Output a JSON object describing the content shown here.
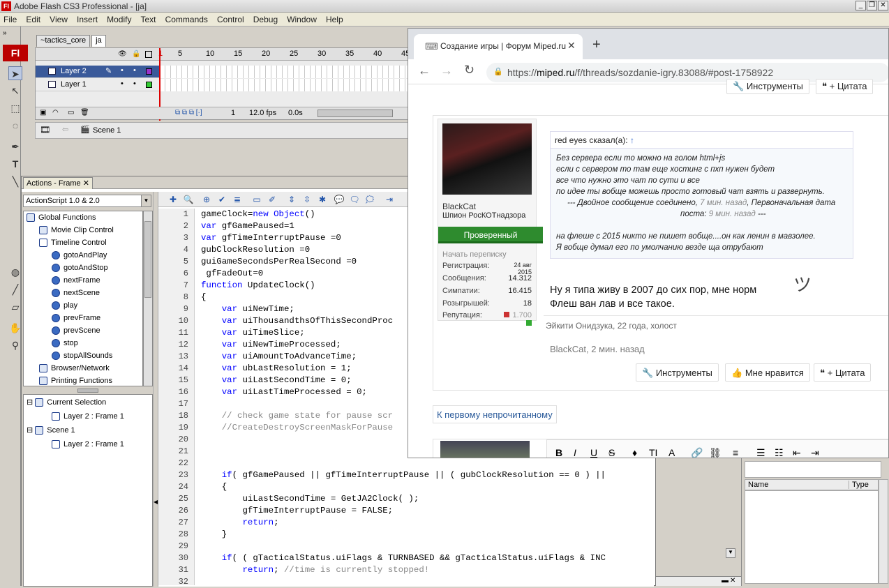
{
  "app": {
    "title": "Adobe Flash CS3 Professional - [ja]",
    "logo": "Fl",
    "menu": [
      "File",
      "Edit",
      "View",
      "Insert",
      "Modify",
      "Text",
      "Commands",
      "Control",
      "Debug",
      "Window",
      "Help"
    ]
  },
  "doc_tabs": [
    "~tactics_core",
    "ja"
  ],
  "timeline": {
    "frame_numbers": [
      "1",
      "5",
      "10",
      "15",
      "20",
      "25",
      "30",
      "35",
      "40",
      "45"
    ],
    "layers": [
      {
        "name": "Layer 2",
        "color": "#9933cc",
        "selected": true
      },
      {
        "name": "Layer 1",
        "color": "#33cc33",
        "selected": false
      }
    ],
    "current_frame": "1",
    "fps": "12.0 fps",
    "time": "0.0s"
  },
  "scene": {
    "name": "Scene 1"
  },
  "actions_panel": {
    "tab": "Actions - Frame",
    "version": "ActionScript 1.0 & 2.0",
    "tree": [
      {
        "label": "Global Functions",
        "level": 0,
        "icon": "book"
      },
      {
        "label": "Movie Clip Control",
        "level": 1,
        "icon": "book"
      },
      {
        "label": "Timeline Control",
        "level": 1,
        "icon": "book-open"
      },
      {
        "label": "gotoAndPlay",
        "level": 2,
        "icon": "circle"
      },
      {
        "label": "gotoAndStop",
        "level": 2,
        "icon": "circle"
      },
      {
        "label": "nextFrame",
        "level": 2,
        "icon": "circle"
      },
      {
        "label": "nextScene",
        "level": 2,
        "icon": "circle"
      },
      {
        "label": "play",
        "level": 2,
        "icon": "circle"
      },
      {
        "label": "prevFrame",
        "level": 2,
        "icon": "circle"
      },
      {
        "label": "prevScene",
        "level": 2,
        "icon": "circle"
      },
      {
        "label": "stop",
        "level": 2,
        "icon": "circle"
      },
      {
        "label": "stopAllSounds",
        "level": 2,
        "icon": "circle"
      },
      {
        "label": "Browser/Network",
        "level": 1,
        "icon": "book"
      },
      {
        "label": "Printing Functions",
        "level": 1,
        "icon": "book"
      }
    ],
    "script_nav": [
      {
        "label": "Current Selection",
        "level": 0
      },
      {
        "label": "Layer 2 : Frame 1",
        "level": 1
      },
      {
        "label": "Scene 1",
        "level": 0
      },
      {
        "label": "Layer 2 : Frame 1",
        "level": 1
      }
    ],
    "code_lines": [
      "gameClock=new Object()",
      "var gfGamePaused=1",
      "var gfTimeInterruptPause =0",
      "gubClockResolution =0",
      "guiGameSecondsPerRealSecond =0",
      " gfFadeOut=0",
      "function UpdateClock()",
      "{",
      "    var uiNewTime;",
      "    var uiThousandthsOfThisSecondProc",
      "    var uiTimeSlice;",
      "    var uiNewTimeProcessed;",
      "    var uiAmountToAdvanceTime;",
      "    var ubLastResolution = 1;",
      "    var uiLastSecondTime = 0;",
      "    var uiLastTimeProcessed = 0;",
      "",
      "    // check game state for pause scr",
      "    //CreateDestroyScreenMaskForPause",
      "",
      "",
      "",
      "    if( gfGamePaused || gfTimeInterruptPause || ( gubClockResolution == 0 ) ||",
      "    {",
      "        uiLastSecondTime = GetJA2Clock( );",
      "        gfTimeInterruptPause = FALSE;",
      "        return;",
      "    }",
      "",
      "    if( ( gTacticalStatus.uiFlags & TURNBASED && gTacticalStatus.uiFlags & INC",
      "        return; //time is currently stopped!",
      ""
    ]
  },
  "browser": {
    "tab_title": "Создание игры | Форум Miped.ru",
    "url": "https://miped.ru/f/threads/sozdanie-igry.83088/#post-1758922",
    "url_host": "miped.ru",
    "top_buttons": [
      "Инструменты",
      "+ Цитата"
    ],
    "post": {
      "username": "BlackCat",
      "usertitle": "Шпион РосКОТнадзора",
      "badge": "Проверенный",
      "start_conversation": "Начать переписку",
      "stats": [
        {
          "label": "Регистрация:",
          "value": "24 авг 2015"
        },
        {
          "label": "Сообщения:",
          "value": "14.312"
        },
        {
          "label": "Симпатии:",
          "value": "16.415"
        },
        {
          "label": "Розыгрышей:",
          "value": "18"
        },
        {
          "label": "Репутация:",
          "value": "1.700"
        }
      ],
      "quote_author": "red eyes сказал(а):",
      "quote_arrow": "↑",
      "quote_lines": [
        "Без сервера если то можно на голом html+js",
        "если с сервером то там еще хостинг с пхп нужен будет",
        "все что нужно это чат по сути и все",
        "по идее ты вобще можешь просто готовый чат взять и развернуть."
      ],
      "merge_note_1": "--- Двойное сообщение соединено, ",
      "merge_time_1": "7 мин. назад",
      "merge_note_2": ", Первоначальная дата",
      "merge_note_3": "поста: ",
      "merge_time_2": "9 мин. назад",
      "merge_note_4": " ---",
      "quote_lines2": [
        "на флеше с 2015 никто не пишет вобще....он как ленин в мавзолее.",
        "Я вобще думал его по умолчанию везде ща отрубают"
      ],
      "reply_lines": [
        "Ну я типа живу в 2007 до сих пор, мне норм",
        "Флеш ван лав и все такое."
      ],
      "signature": "Эйкити Онидзука, 22 года, холост",
      "footer": "BlackCat, 2 мин. назад",
      "actions": [
        "Инструменты",
        "Мне нравится",
        "+ Цитата"
      ]
    },
    "unread_link": "К первому непрочитанному"
  },
  "right_panel": {
    "columns": [
      "Name",
      "Type"
    ]
  }
}
